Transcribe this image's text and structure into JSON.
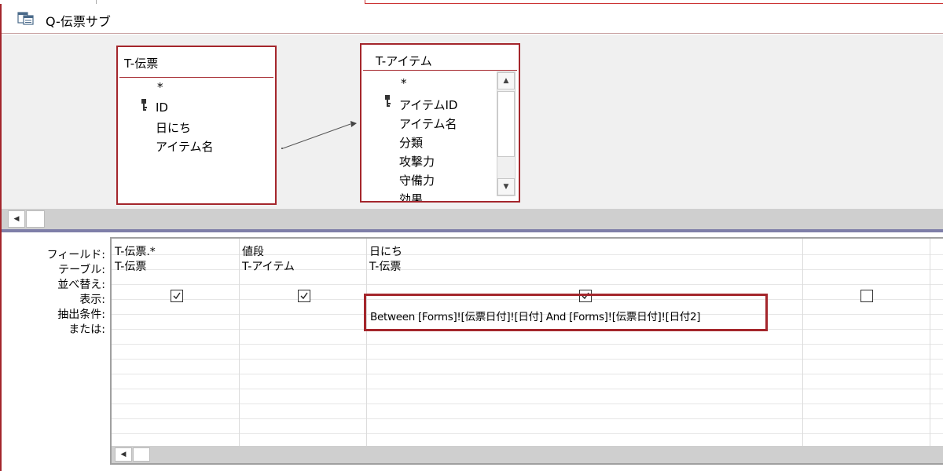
{
  "window": {
    "tab_title": "Q-伝票サブ"
  },
  "tables": {
    "slip": {
      "title": "T-伝票",
      "fields": [
        "*",
        "ID",
        "日にち",
        "アイテム名"
      ]
    },
    "item": {
      "title": "T-アイテム",
      "fields": [
        "*",
        "アイテムID",
        "アイテム名",
        "分類",
        "攻撃力",
        "守備力",
        "効果"
      ]
    }
  },
  "grid": {
    "row_labels": {
      "field": "フィールド:",
      "table": "テーブル:",
      "sort": "並べ替え:",
      "show": "表示:",
      "criteria": "抽出条件:",
      "or": "または:"
    },
    "columns": [
      {
        "field": "T-伝票.*",
        "table": "T-伝票",
        "show": true,
        "criteria": ""
      },
      {
        "field": "値段",
        "table": "T-アイテム",
        "show": true,
        "criteria": ""
      },
      {
        "field": "日にち",
        "table": "T-伝票",
        "show": true,
        "criteria": "Between [Forms]![伝票日付]![日付] And [Forms]![伝票日付]![日付2]"
      },
      {
        "field": "",
        "table": "",
        "show": false,
        "criteria": ""
      }
    ]
  }
}
